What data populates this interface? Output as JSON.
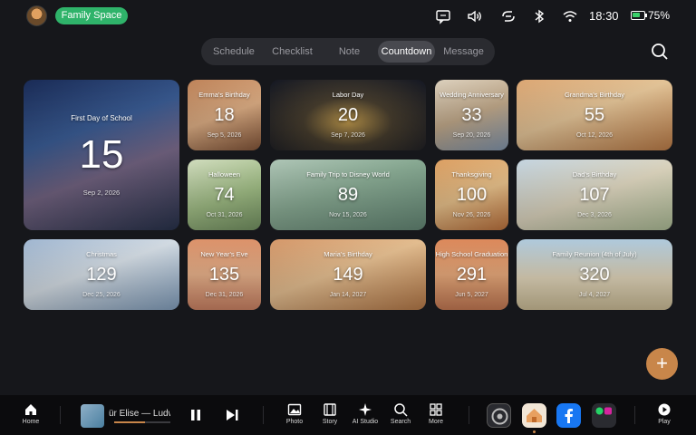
{
  "header": {
    "family_label": "Family Space",
    "time": "18:30",
    "battery_pct": "75%",
    "battery_level": 0.75,
    "status_icons": [
      "message-icon",
      "volume-icon",
      "link-icon",
      "bluetooth-icon",
      "wifi-icon"
    ]
  },
  "tabs": [
    {
      "label": "Schedule"
    },
    {
      "label": "Checklist"
    },
    {
      "label": "Note"
    },
    {
      "label": "Countdown",
      "active": true
    },
    {
      "label": "Message"
    }
  ],
  "countdowns": [
    {
      "title": "First Day of School",
      "days": "15",
      "date": "Sep 2, 2026"
    },
    {
      "title": "Emma's Birthday",
      "days": "18",
      "date": "Sep 5, 2026"
    },
    {
      "title": "Labor Day",
      "days": "20",
      "date": "Sep 7, 2026"
    },
    {
      "title": "Wedding Anniversary",
      "days": "33",
      "date": "Sep 20, 2026"
    },
    {
      "title": "Grandma's Birthday",
      "days": "55",
      "date": "Oct 12, 2026"
    },
    {
      "title": "Halloween",
      "days": "74",
      "date": "Oct 31, 2026"
    },
    {
      "title": "Family Trip to Disney World",
      "days": "89",
      "date": "Nov 15, 2026"
    },
    {
      "title": "Thanksgiving",
      "days": "100",
      "date": "Nov 26, 2026"
    },
    {
      "title": "Dad's Birthday",
      "days": "107",
      "date": "Dec 3, 2026"
    },
    {
      "title": "Christmas",
      "days": "129",
      "date": "Dec 25, 2026"
    },
    {
      "title": "New Year's Eve",
      "days": "135",
      "date": "Dec 31, 2026"
    },
    {
      "title": "Maria's Birthday",
      "days": "149",
      "date": "Jan 14, 2027"
    },
    {
      "title": "High School Graduation",
      "days": "291",
      "date": "Jun 5, 2027"
    },
    {
      "title": "Family Reunion (4th of July)",
      "days": "320",
      "date": "Jul 4, 2027"
    }
  ],
  "fab": {
    "label": "+"
  },
  "dock": {
    "home": "Home",
    "track": "ür Elise — Ludwig van Beethoven",
    "track_progress": 0.55,
    "photo": "Photo",
    "story": "Story",
    "ai_studio": "AI Studio",
    "search": "Search",
    "more": "More",
    "play": "Play"
  }
}
